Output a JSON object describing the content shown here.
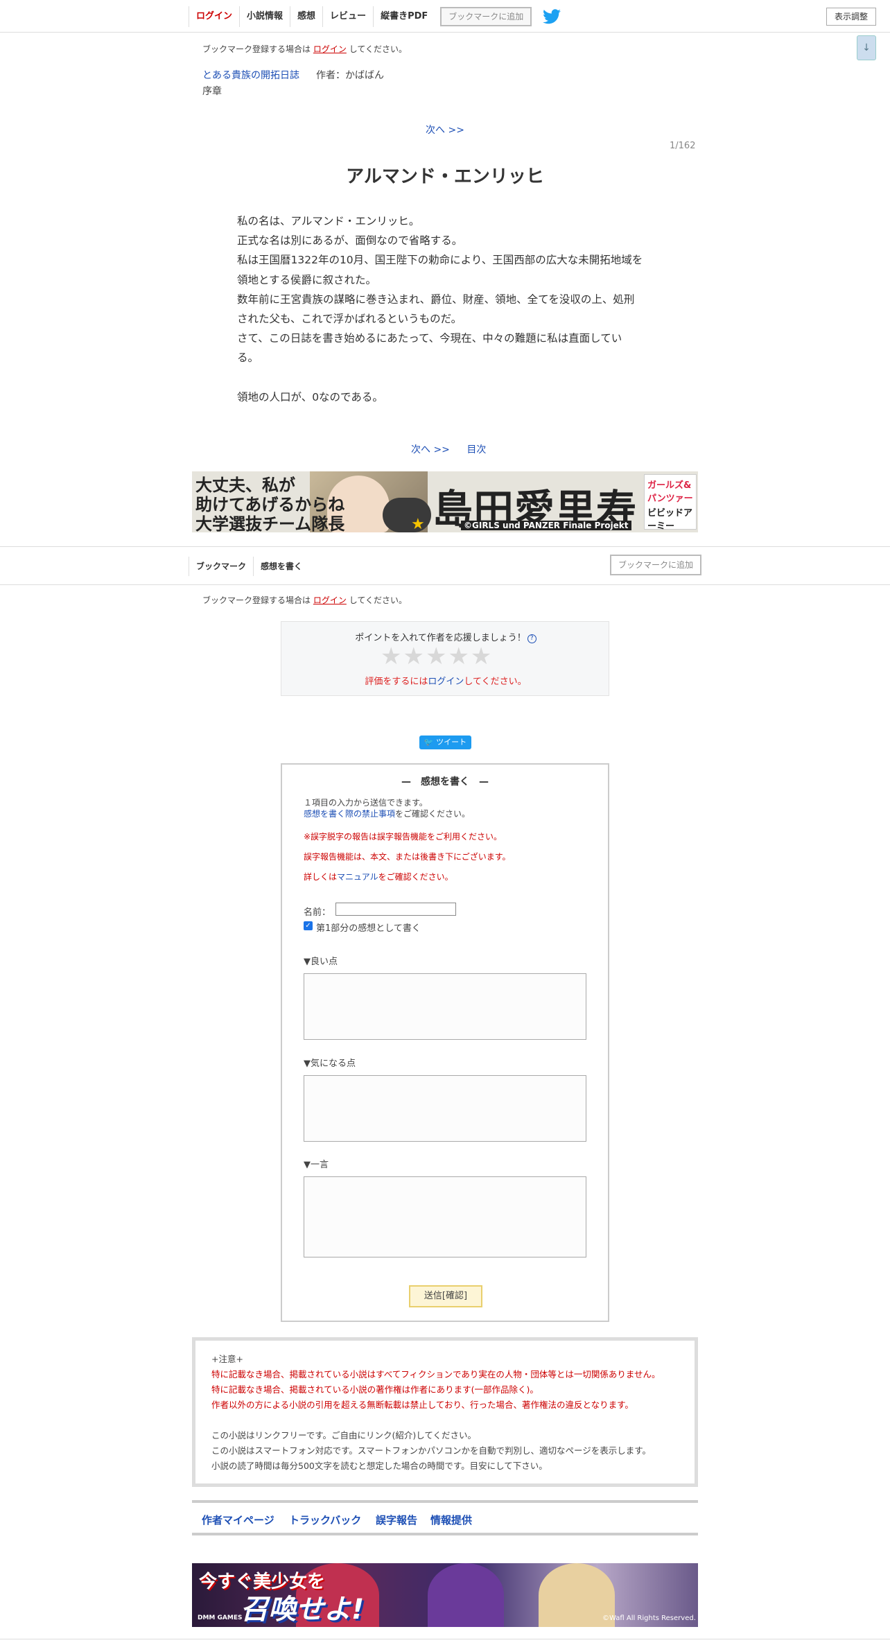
{
  "nav": {
    "login": "ログイン",
    "novel_info": "小説情報",
    "impressions": "感想",
    "review": "レビュー",
    "vertical_pdf": "縦書きPDF",
    "bookmark_add": "ブックマークに追加",
    "display_adjust": "表示調整",
    "scroll_down": "↓"
  },
  "bookmark_notice": {
    "prefix": "ブックマーク登録する場合は",
    "link": "ログイン",
    "suffix": "してください。"
  },
  "novel": {
    "title": "とある貴族の開拓日誌",
    "author": "作者：かばばん",
    "chapter": "序章",
    "next_top": "次へ >>",
    "page_no": "1/162",
    "episode_title": "アルマンド・エンリッヒ",
    "body": [
      "私の名は、アルマンド・エンリッヒ。",
      "正式な名は別にあるが、面倒なので省略する。",
      "私は王国暦1322年の10月、国王陛下の勅命により、王国西部の広大な未開拓地域を",
      "領地とする侯爵に叙された。",
      "数年前に王宮貴族の謀略に巻き込まれ、爵位、財産、領地、全てを没収の上、処刑",
      "された父も、これで浮かばれるというものだ。",
      "さて、この日誌を書き始めるにあたって、今現在、中々の難題に私は直面してい",
      "る。",
      "",
      "領地の人口が、0なのである。"
    ],
    "next_bottom": "次へ >>",
    "toc": "目次"
  },
  "banner1": {
    "line1": "大丈夫、私が",
    "line2": "助けてあげるからね",
    "line3": "大学選抜チーム隊長",
    "name": "島田愛里寿",
    "copyright": "©GIRLS und PANZER Finale Projekt",
    "logo1": "ガールズ&パンツァー",
    "logo2": "ビビッドアーミー"
  },
  "nav2": {
    "bookmark": "ブックマーク",
    "write_impression": "感想を書く",
    "bookmark_add": "ブックマークに追加"
  },
  "rating": {
    "title": "ポイントを入れて作者を応援しましょう！",
    "help": "?",
    "stars": "★★★★★",
    "login_prefix": "評価をするには",
    "login_link": "ログイン",
    "login_suffix": "してください。"
  },
  "tweet": "ツイート",
  "form": {
    "header": "—　感想を書く　—",
    "line1": "１項目の入力から送信できます。",
    "rules_link": "感想を書く際の禁止事項",
    "rules_suffix": "をご確認ください。",
    "typo1": "※誤字脱字の報告は誤字報告機能をご利用ください。",
    "typo2": "誤字報告機能は、本文、または後書き下にございます。",
    "typo3_prefix": "詳しくは",
    "typo3_link": "マニュアル",
    "typo3_suffix": "をご確認ください。",
    "name_label": "名前：",
    "checkbox_label": "第1部分の感想として書く",
    "good": "▼良い点",
    "concern": "▼気になる点",
    "oneword": "▼一言",
    "submit": "送信[確認]"
  },
  "notice": {
    "head": "+注意+",
    "r1": "特に記載なき場合、掲載されている小説はすべてフィクションであり実在の人物・団体等とは一切関係ありません。",
    "r2": "特に記載なき場合、掲載されている小説の著作権は作者にあります(一部作品除く)。",
    "r3": "作者以外の方による小説の引用を超える無断転載は禁止しており、行った場合、著作権法の違反となります。",
    "g1": "この小説はリンクフリーです。ご自由にリンク(紹介)してください。",
    "g2": "この小説はスマートフォン対応です。スマートフォンかパソコンかを自動で判別し、適切なページを表示します。",
    "g3": "小説の読了時間は毎分500文字を読むと想定した場合の時間です。目安にして下さい。"
  },
  "footer": {
    "author_page": "作者マイページ",
    "trackback": "トラックバック",
    "typo_report": "誤字報告",
    "info": "情報提供"
  },
  "banner2": {
    "line1": "今すぐ美少女を",
    "line2": "召喚せよ!",
    "dmm": "DMM GAMES",
    "copy": "©Wafl All Rights Reserved."
  },
  "colors": {
    "link": "#1d4fb5",
    "red": "#cc0000",
    "twitter": "#1d9bf0"
  }
}
